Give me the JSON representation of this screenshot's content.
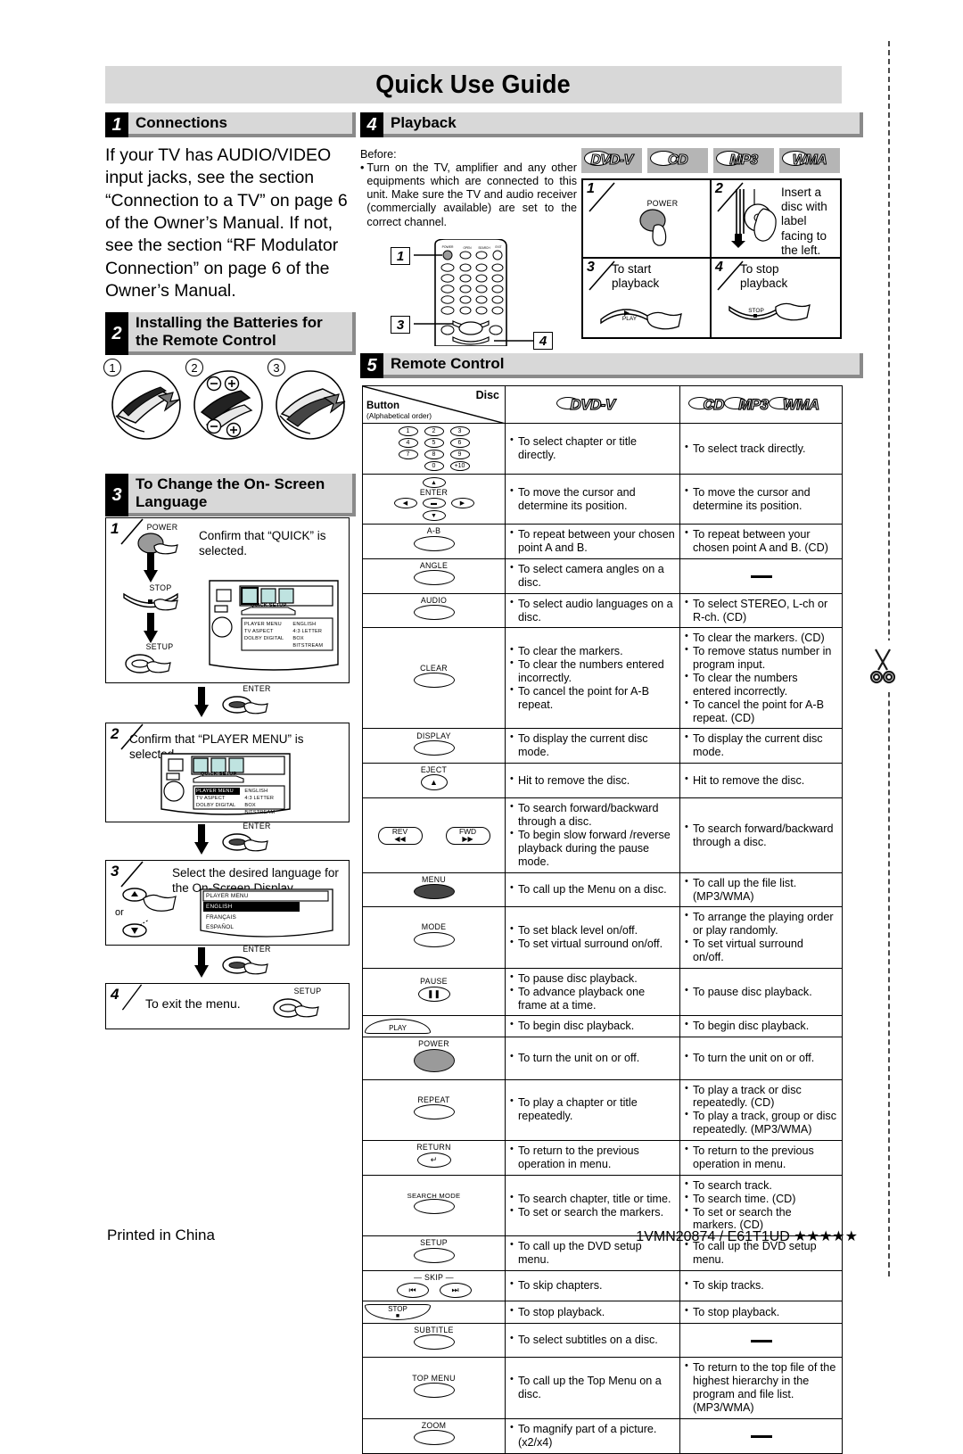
{
  "document": {
    "title": "Quick Use Guide",
    "footer_left": "Printed in China",
    "footer_right": "1VMN20874 / E61T1UD ★★★★★"
  },
  "sections": {
    "connections": {
      "number": "1",
      "title": "Connections",
      "body": "If your TV has AUDIO/VIDEO input jacks, see the section “Connection to a TV” on page 6 of the Owner’s Manual. If not, see the section “RF Modulator Connection” on page 6 of the Owner’s Manual."
    },
    "batteries": {
      "number": "2",
      "title": "Installing the Batteries for the Remote Control",
      "steps": [
        "1",
        "2",
        "3"
      ],
      "polarity": [
        "−",
        "+"
      ]
    },
    "language": {
      "number": "3",
      "title": "To Change the On- Screen Language",
      "steps": [
        {
          "num": "1",
          "text": "Confirm that “QUICK” is selected.",
          "buttons": [
            "POWER",
            "STOP",
            "SETUP"
          ],
          "osd": {
            "header": "QUICK SETUP",
            "rows": [
              {
                "label": "PLAYER MENU",
                "value": "ENGLISH"
              },
              {
                "label": "TV ASPECT",
                "value": "4:3 LETTER BOX"
              },
              {
                "label": "DOLBY DIGITAL",
                "value": "BITSTREAM"
              }
            ]
          }
        },
        {
          "num": "2",
          "text": "Confirm that “PLAYER MENU” is selected.",
          "osd": {
            "header": "QUICK SETUP",
            "rows": [
              {
                "label": "PLAYER MENU",
                "value": "ENGLISH"
              },
              {
                "label": "TV ASPECT",
                "value": "4:3 LETTER BOX"
              },
              {
                "label": "DOLBY DIGITAL",
                "value": "BITSTREAM"
              }
            ]
          }
        },
        {
          "num": "3",
          "text": "Select the desired language for the On-Screen Display.",
          "or_label": "or",
          "menu": {
            "header": "PLAYER MENU",
            "options": [
              "ENGLISH",
              "FRANÇAIS",
              "ESPAÑOL"
            ],
            "selected": "ENGLISH"
          }
        },
        {
          "num": "4",
          "text": "To exit the menu.",
          "button": "SETUP"
        }
      ],
      "connector_button": "ENTER"
    },
    "playback": {
      "number": "4",
      "title": "Playback",
      "before_label": "Before:",
      "before_text": "Turn on the TV, amplifier and any other equipments which are connected to this unit. Make sure the TV and audio receiver (commercially available) are set to the correct channel.",
      "badges": [
        "DVD-V",
        "CD",
        "MP3",
        "WMA"
      ],
      "remote_callouts": [
        "1",
        "3",
        "4"
      ],
      "cells": [
        {
          "num": "1",
          "text": "",
          "button": "POWER"
        },
        {
          "num": "2",
          "text": "Insert a disc with label facing to the left."
        },
        {
          "num": "3",
          "text": "To start playback",
          "button": "PLAY"
        },
        {
          "num": "4",
          "text": "To stop playback",
          "button": "STOP"
        }
      ]
    },
    "remote_control": {
      "number": "5",
      "title": "Remote Control",
      "header": {
        "button_label": "Button",
        "button_sub": "(Alphabetical order)",
        "disc_label": "Disc",
        "col_dvd": "DVD-V",
        "col_other": [
          "CD",
          "MP3",
          "WMA"
        ]
      },
      "rows": [
        {
          "button": "number-keys",
          "keys": [
            "1",
            "2",
            "3",
            "4",
            "5",
            "6",
            "7",
            "8",
            "9",
            "0",
            "+10"
          ],
          "dvd": [
            "To select chapter or title directly."
          ],
          "other": [
            "To select track directly."
          ]
        },
        {
          "button": "cursor-enter",
          "label": "ENTER",
          "dvd": [
            "To move the cursor and determine its position."
          ],
          "other": [
            "To move the cursor and determine its position."
          ]
        },
        {
          "button": "A-B",
          "dvd": [
            "To repeat between your chosen point A and B."
          ],
          "other": [
            "To repeat between your chosen point A and B. (CD)"
          ]
        },
        {
          "button": "ANGLE",
          "dvd": [
            "To select camera angles on a disc."
          ],
          "other": []
        },
        {
          "button": "AUDIO",
          "dvd": [
            "To select audio languages on a disc."
          ],
          "other": [
            "To select STEREO, L-ch or R-ch. (CD)"
          ]
        },
        {
          "button": "CLEAR",
          "dvd": [
            "To clear the markers.",
            "To clear the numbers entered incorrectly.",
            "To cancel the point for A-B repeat."
          ],
          "other": [
            "To clear the markers. (CD)",
            "To remove status number in program input.",
            "To clear the numbers entered incorrectly.",
            "To cancel the point for A-B repeat. (CD)"
          ]
        },
        {
          "button": "DISPLAY",
          "dvd": [
            "To display the current disc mode."
          ],
          "other": [
            "To display the current disc mode."
          ]
        },
        {
          "button": "EJECT",
          "dvd": [
            "Hit to remove the disc."
          ],
          "other": [
            "Hit to remove the disc."
          ]
        },
        {
          "button": "REV-FWD",
          "keys": [
            "REV",
            "FWD"
          ],
          "dvd": [
            "To search forward/backward through a disc.",
            "To begin slow forward /reverse playback during the pause mode."
          ],
          "other": [
            "To search forward/backward through a disc."
          ]
        },
        {
          "button": "MENU",
          "dvd": [
            "To call up the Menu on a disc."
          ],
          "other": [
            "To call up the file list. (MP3/WMA)"
          ]
        },
        {
          "button": "MODE",
          "dvd": [
            "To set black level on/off.",
            "To set virtual surround on/off."
          ],
          "other": [
            "To arrange the playing order or play randomly.",
            "To set virtual surround on/off."
          ]
        },
        {
          "button": "PAUSE",
          "dvd": [
            "To pause disc playback.",
            "To advance playback one frame at a time."
          ],
          "other": [
            "To pause disc playback."
          ]
        },
        {
          "button": "PLAY",
          "dvd": [
            "To begin disc playback."
          ],
          "other": [
            "To begin disc playback."
          ]
        },
        {
          "button": "POWER",
          "dvd": [
            "To turn the unit on or off."
          ],
          "other": [
            "To turn the unit on or off."
          ]
        },
        {
          "button": "REPEAT",
          "dvd": [
            "To play a chapter or title repeatedly."
          ],
          "other": [
            "To play a track or disc repeatedly. (CD)",
            "To play a track, group or disc repeatedly. (MP3/WMA)"
          ]
        },
        {
          "button": "RETURN",
          "dvd": [
            "To return to the previous operation in menu."
          ],
          "other": [
            "To return to the previous operation in menu."
          ]
        },
        {
          "button": "SEARCH MODE",
          "dvd": [
            "To search chapter, title or time.",
            "To set or search the markers."
          ],
          "other": [
            "To search track.",
            "To search time. (CD)",
            "To set or search the markers. (CD)"
          ]
        },
        {
          "button": "SETUP",
          "dvd": [
            "To call up the DVD setup menu."
          ],
          "other": [
            "To call up the DVD setup menu."
          ]
        },
        {
          "button": "SKIP",
          "dvd": [
            "To skip chapters."
          ],
          "other": [
            "To skip tracks."
          ]
        },
        {
          "button": "STOP",
          "dvd": [
            "To stop playback."
          ],
          "other": [
            "To stop playback."
          ]
        },
        {
          "button": "SUBTITLE",
          "dvd": [
            "To select subtitles on a disc."
          ],
          "other": []
        },
        {
          "button": "TOP MENU",
          "dvd": [
            "To call up the Top Menu on a disc."
          ],
          "other": [
            "To return to the top file of the highest hierarchy in the program and file list. (MP3/WMA)"
          ]
        },
        {
          "button": "ZOOM",
          "dvd": [
            "To magnify part of a picture. (x2/x4)"
          ],
          "other": []
        }
      ]
    }
  },
  "icons": {
    "scissors": "✂",
    "cutline": "dashed-cut-line"
  }
}
